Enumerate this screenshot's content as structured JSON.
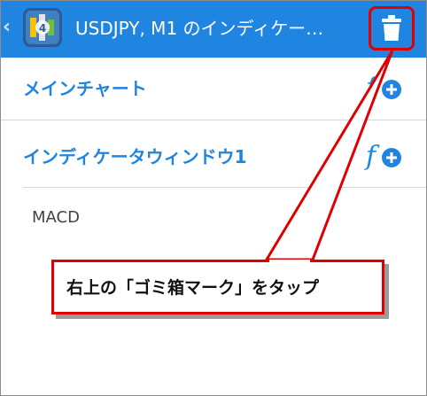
{
  "appbar": {
    "title": "USDJPY, M1 のインディケー…"
  },
  "rows": [
    {
      "label": "メインチャート",
      "icon": "function-plus-icon"
    },
    {
      "label": "インディケータウィンドウ1",
      "icon": "function-plus-icon"
    }
  ],
  "indicators": [
    {
      "label": "MACD"
    }
  ],
  "callout": {
    "text": "右上の「ゴミ箱マーク」をタップ"
  },
  "colors": {
    "appbar": "#1f85e0",
    "accent": "#1f85e0",
    "highlight": "#e00000"
  }
}
